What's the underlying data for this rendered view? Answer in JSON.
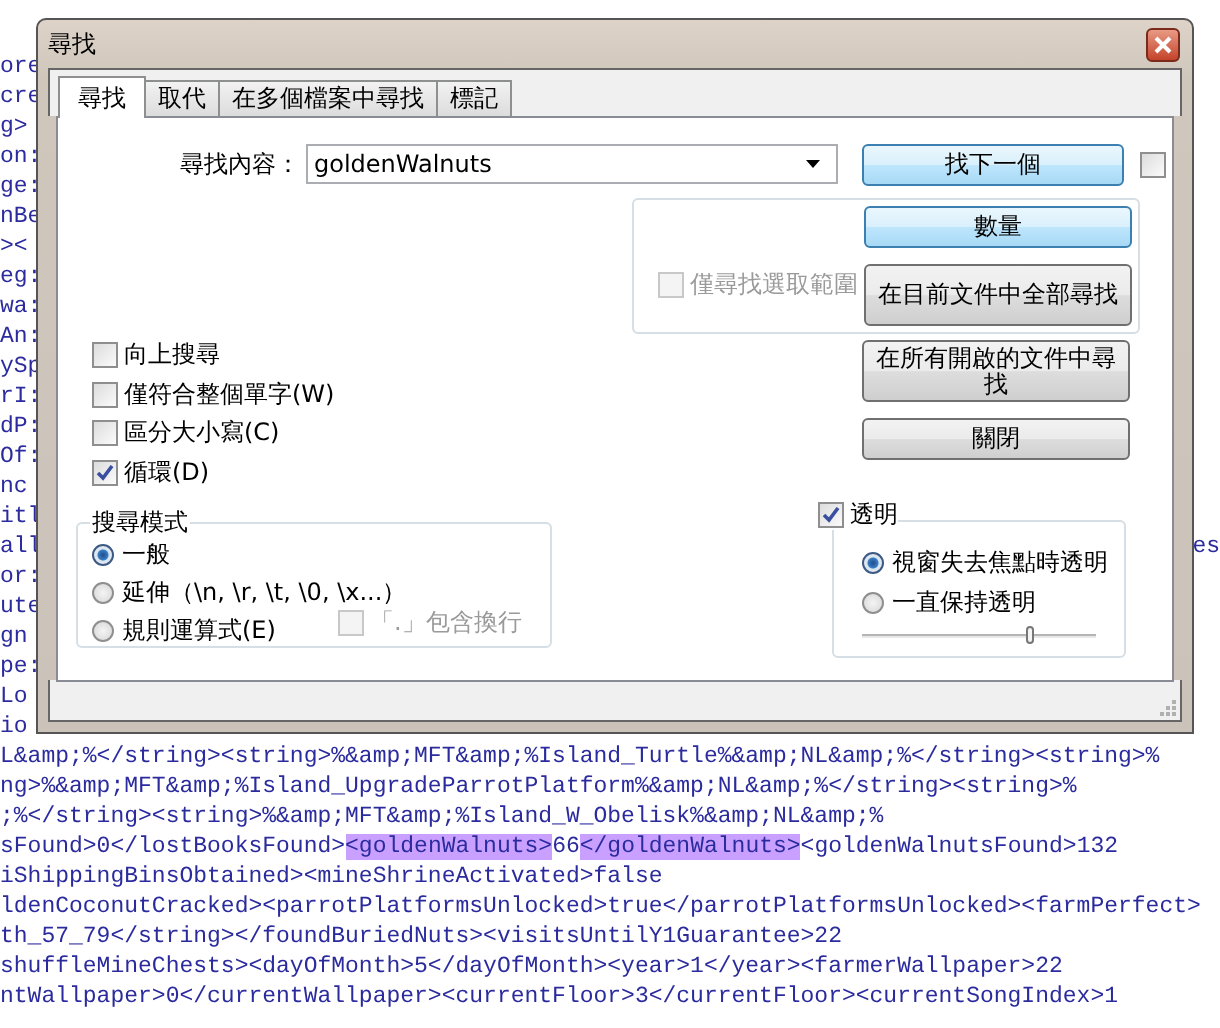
{
  "editor": {
    "stub_lines": [
      {
        "left": "ore"
      },
      {
        "left": "cre"
      },
      {
        "left": "g>"
      },
      {
        "left": "on:"
      },
      {
        "left": "ge:"
      },
      {
        "left": "nBe"
      },
      {
        "left": "><"
      },
      {
        "left": "eg:"
      },
      {
        "left": "wa:"
      },
      {
        "left": "An:"
      },
      {
        "left": "ySp"
      },
      {
        "left": "rI:"
      },
      {
        "left": "dP:"
      },
      {
        "left": "Of:"
      },
      {
        "left": "nc"
      },
      {
        "left": "itl"
      },
      {
        "left": "all",
        "right": "es"
      },
      {
        "left": "or:"
      },
      {
        "left": "ute"
      },
      {
        "left": "gn"
      },
      {
        "left": "pe:"
      },
      {
        "left": "Lo"
      },
      {
        "left": "io"
      }
    ],
    "lines": [
      {
        "segments": [
          {
            "text": "L&amp;%</string><string>%&amp;MFT&amp;%Island_Turtle%&amp;NL&amp;%</string><string>%",
            "highlighted": false
          }
        ]
      },
      {
        "segments": [
          {
            "text": "ng>%&amp;MFT&amp;%Island_UpgradeParrotPlatform%&amp;NL&amp;%</string><string>%",
            "highlighted": false
          }
        ]
      },
      {
        "segments": [
          {
            "text": ";%</string><string>%&amp;MFT&amp;%Island_W_Obelisk%&amp;NL&amp;%",
            "highlighted": false
          }
        ]
      },
      {
        "segments": [
          {
            "text": "sFound>0</lostBooksFound>",
            "highlighted": false
          },
          {
            "text": "<goldenWalnuts>",
            "highlighted": true
          },
          {
            "text": "66",
            "highlighted": false
          },
          {
            "text": "</goldenWalnuts>",
            "highlighted": true
          },
          {
            "text": "<goldenWalnutsFound>132",
            "highlighted": false
          }
        ]
      },
      {
        "segments": [
          {
            "text": "iShippingBinsObtained><mineShrineActivated>false",
            "highlighted": false
          }
        ]
      },
      {
        "segments": [
          {
            "text": "ldenCoconutCracked><parrotPlatformsUnlocked>true</parrotPlatformsUnlocked><farmPerfect>",
            "highlighted": false
          }
        ]
      },
      {
        "segments": [
          {
            "text": "th_57_79</string></foundBuriedNuts><visitsUntilY1Guarantee>22",
            "highlighted": false
          }
        ]
      },
      {
        "segments": [
          {
            "text": "shuffleMineChests><dayOfMonth>5</dayOfMonth><year>1</year><farmerWallpaper>22",
            "highlighted": false
          }
        ]
      },
      {
        "segments": [
          {
            "text": "ntWallpaper>0</currentWallpaper><currentFloor>3</currentFloor><currentSongIndex>1",
            "highlighted": false
          }
        ]
      }
    ]
  },
  "dialog": {
    "title": "尋找",
    "tabs": [
      {
        "label": "尋找",
        "selected": true
      },
      {
        "label": "取代",
        "selected": false
      },
      {
        "label": "在多個檔案中尋找",
        "selected": false
      },
      {
        "label": "標記",
        "selected": false
      }
    ],
    "find_label": "尋找內容：",
    "find_value": "goldenWalnuts",
    "side_checkbox": {
      "checked": false
    },
    "selection_checkbox": {
      "label": "僅尋找選取範圍",
      "checked": false,
      "disabled": true
    },
    "buttons": [
      {
        "label": "找下一個",
        "highlighted": true
      },
      {
        "label": "數量",
        "highlighted": true
      },
      {
        "label": "在目前文件中全部尋找",
        "highlighted": false
      },
      {
        "label": "在所有開啟的文件中尋找",
        "highlighted": false
      },
      {
        "label": "關閉",
        "highlighted": false
      }
    ],
    "options": [
      {
        "label": "向上搜尋",
        "checked": false
      },
      {
        "label": "僅符合整個單字(W)",
        "checked": false
      },
      {
        "label": "區分大小寫(C)",
        "checked": false
      },
      {
        "label": "循環(D)",
        "checked": true
      }
    ],
    "search_mode": {
      "title": "搜尋模式",
      "modes": [
        {
          "label": "一般",
          "selected": true
        },
        {
          "label": "延伸（\\n, \\r, \\t, \\0, \\x...）",
          "selected": false
        },
        {
          "label": "規則運算式(E)",
          "selected": false
        }
      ],
      "dot_newline": {
        "label": "「.」包含換行",
        "checked": false,
        "disabled": true
      }
    },
    "transparency": {
      "label": "透明",
      "checked": true,
      "modes": [
        {
          "label": "視窗失去焦點時透明",
          "selected": true
        },
        {
          "label": "一直保持透明",
          "selected": false
        }
      ],
      "level": 0.72
    }
  }
}
